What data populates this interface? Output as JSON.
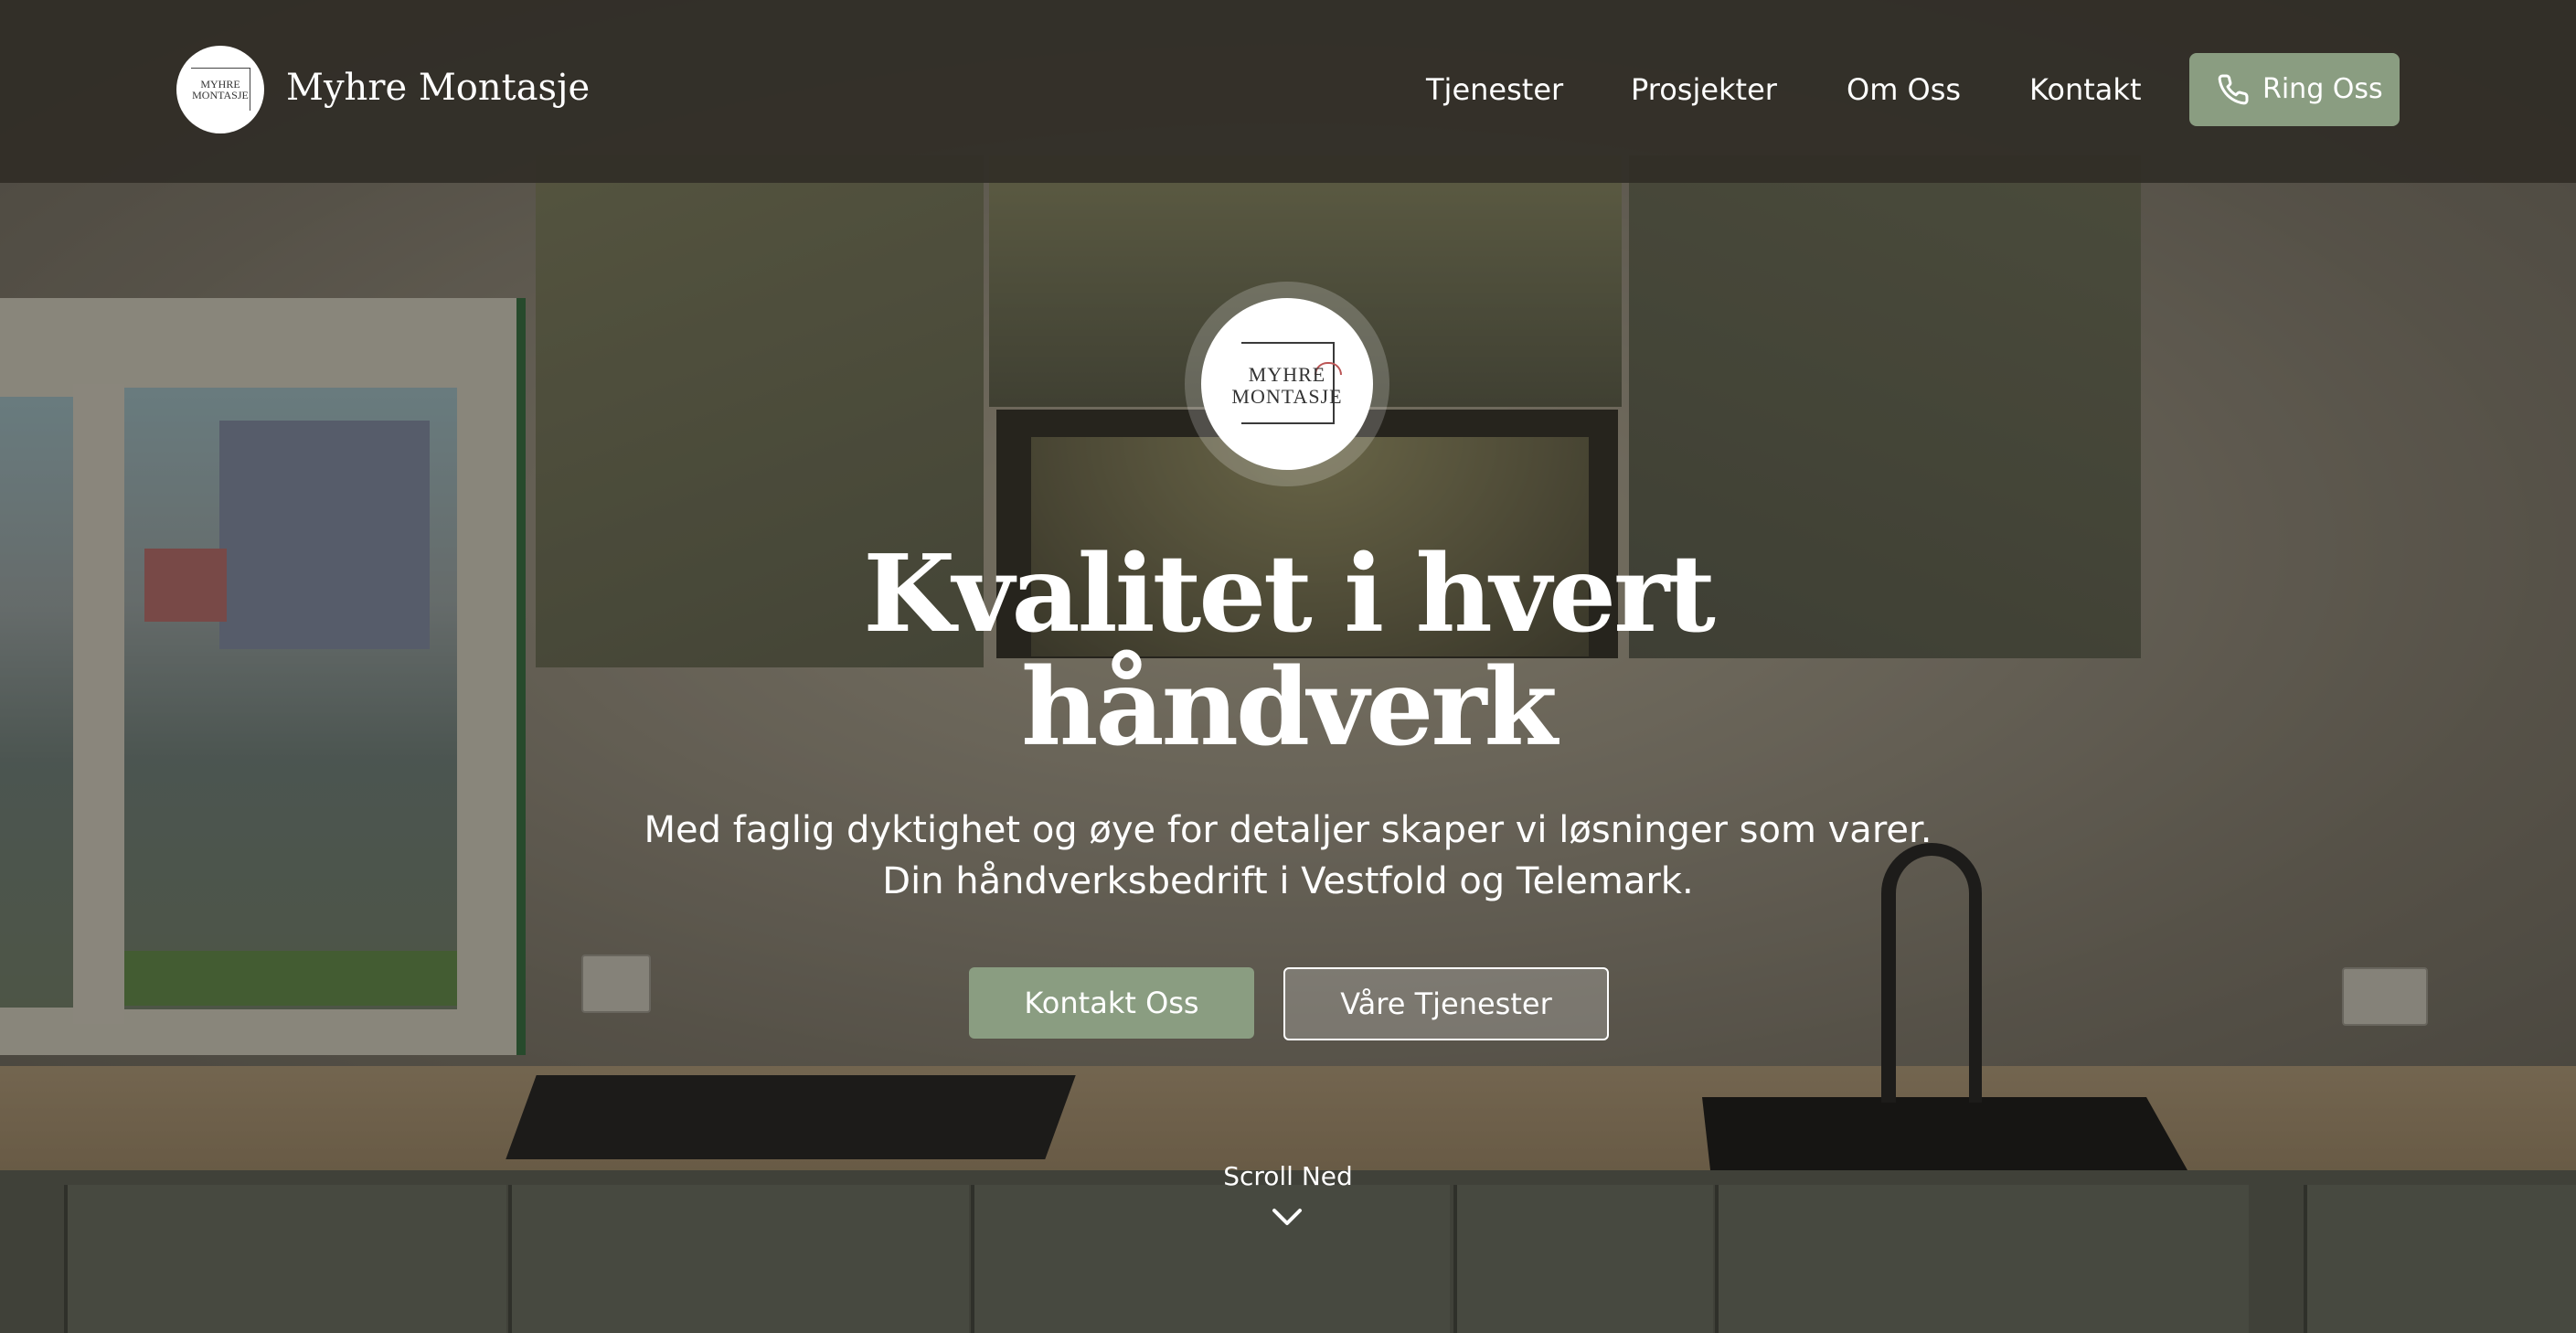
{
  "header": {
    "brand_name": "Myhre Montasje",
    "logo_text": "MYHRE MONTASJE",
    "nav": [
      "Tjenester",
      "Prosjekter",
      "Om Oss",
      "Kontakt"
    ],
    "call_button": "Ring Oss",
    "call_icon": "phone-icon"
  },
  "hero": {
    "logo_text": "MYHRE MONTASJE",
    "headline_line1": "Kvalitet i hvert",
    "headline_line2": "håndverk",
    "subtitle_line1": "Med faglig dyktighet og øye for detaljer skaper vi løsninger som varer.",
    "subtitle_line2": "Din håndverksbedrift i Vestfold og Telemark.",
    "primary_button": "Kontakt Oss",
    "secondary_button": "Våre Tjenester",
    "scroll_label": "Scroll Ned",
    "scroll_icon": "chevron-down-icon"
  },
  "colors": {
    "accent": "#8a9d81",
    "header_bg": "#302c26",
    "text": "#ffffff"
  }
}
